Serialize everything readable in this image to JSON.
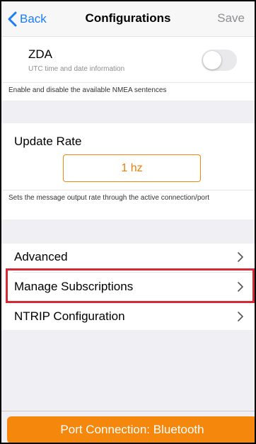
{
  "nav": {
    "back_label": "Back",
    "title": "Configurations",
    "save_label": "Save"
  },
  "zda": {
    "title": "ZDA",
    "subtitle": "UTC time and date information",
    "enabled": false,
    "footer": "Enable and disable the available NMEA sentences"
  },
  "update_rate": {
    "title": "Update Rate",
    "value": "1 hz",
    "footer": "Sets the message output rate through the active connection/port"
  },
  "menu": {
    "items": [
      {
        "label": "Advanced"
      },
      {
        "label": "Manage Subscriptions",
        "highlighted": true
      },
      {
        "label": "NTRIP Configuration"
      }
    ]
  },
  "port_button": {
    "label": "Port Connection: Bluetooth"
  },
  "colors": {
    "accent_blue": "#1b7cf5",
    "accent_orange": "#f5870d",
    "highlight_red": "#d42a35",
    "background_gray": "#efeff4"
  }
}
